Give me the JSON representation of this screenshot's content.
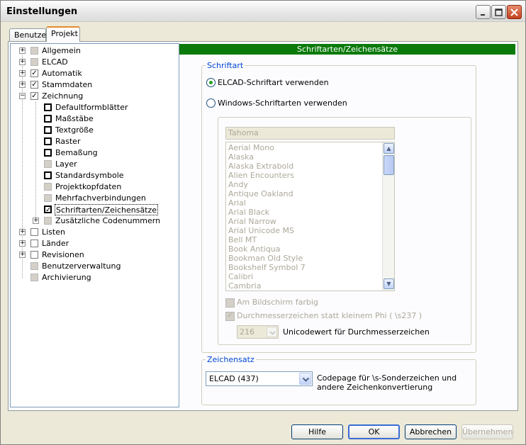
{
  "window": {
    "title": "Einstellungen"
  },
  "title_buttons": {
    "minimize": "_",
    "maximize": "□",
    "close": "✕"
  },
  "tabs": [
    {
      "label": "Benutzer"
    },
    {
      "label": "Projekt"
    }
  ],
  "tree": {
    "items": [
      {
        "label": "Allgemein",
        "expand": "+",
        "check": ""
      },
      {
        "label": "ELCAD",
        "expand": "+",
        "check": ""
      },
      {
        "label": "Automatik",
        "expand": "+",
        "check": "✓"
      },
      {
        "label": "Stammdaten",
        "expand": "+",
        "check": "✓"
      },
      {
        "label": "Zeichnung",
        "expand": "−",
        "check": "✓"
      },
      {
        "label": "Defaultformblätter",
        "check": ""
      },
      {
        "label": "Maßstäbe",
        "check": ""
      },
      {
        "label": "Textgröße",
        "check": ""
      },
      {
        "label": "Raster",
        "check": ""
      },
      {
        "label": "Bemaßung",
        "check": ""
      },
      {
        "label": "Layer",
        "check": ""
      },
      {
        "label": "Standardsymbole",
        "check": ""
      },
      {
        "label": "Projektkopfdaten",
        "check": ""
      },
      {
        "label": "Mehrfachverbindungen",
        "check": ""
      },
      {
        "label": "Schriftarten/Zeichensätze",
        "check": "✓"
      },
      {
        "label": "Zusätzliche Codenummern",
        "expand": "+",
        "check": ""
      },
      {
        "label": "Listen",
        "expand": "+",
        "check": ""
      },
      {
        "label": "Länder",
        "expand": "+",
        "check": ""
      },
      {
        "label": "Revisionen",
        "expand": "+",
        "check": ""
      },
      {
        "label": "Benutzerverwaltung",
        "check": ""
      },
      {
        "label": "Archivierung",
        "check": ""
      }
    ]
  },
  "panel": {
    "header": "Schriftarten/Zeichensätze",
    "schriftart": {
      "legend": "Schriftart",
      "radio_elcad": "ELCAD-Schriftart verwenden",
      "radio_windows": "Windows-Schriftarten verwenden",
      "font_input": "Tahoma",
      "fonts": [
        "Aerial Mono",
        "Alaska",
        "Alaska Extrabold",
        "Alien Encounters",
        "Andy",
        "Antique Oakland",
        "Arial",
        "Arial Black",
        "Arial Narrow",
        "Arial Unicode MS",
        "Bell MT",
        "Book Antiqua",
        "Bookman Old Style",
        "Bookshelf Symbol 7",
        "Calibri",
        "Cambria"
      ],
      "scroll_up": "▲",
      "scroll_down": "▼",
      "check_bildschirm": "Am Bildschirm farbig",
      "check_durchmesser": "Durchmesserzeichen statt kleinem Phi ( \\s237 )",
      "check_mark": "✓",
      "unicode_value": "216",
      "unicode_label": "Unicodewert für Durchmesserzeichen"
    },
    "zeichensatz": {
      "legend": "Zeichensatz",
      "select_value": "ELCAD (437)",
      "description": "Codepage für \\s-Sonderzeichen und andere Zeichenkonvertierung"
    }
  },
  "buttons": {
    "help": "Hilfe",
    "ok": "OK",
    "cancel": "Abbrechen",
    "apply": "Übernehmen"
  }
}
